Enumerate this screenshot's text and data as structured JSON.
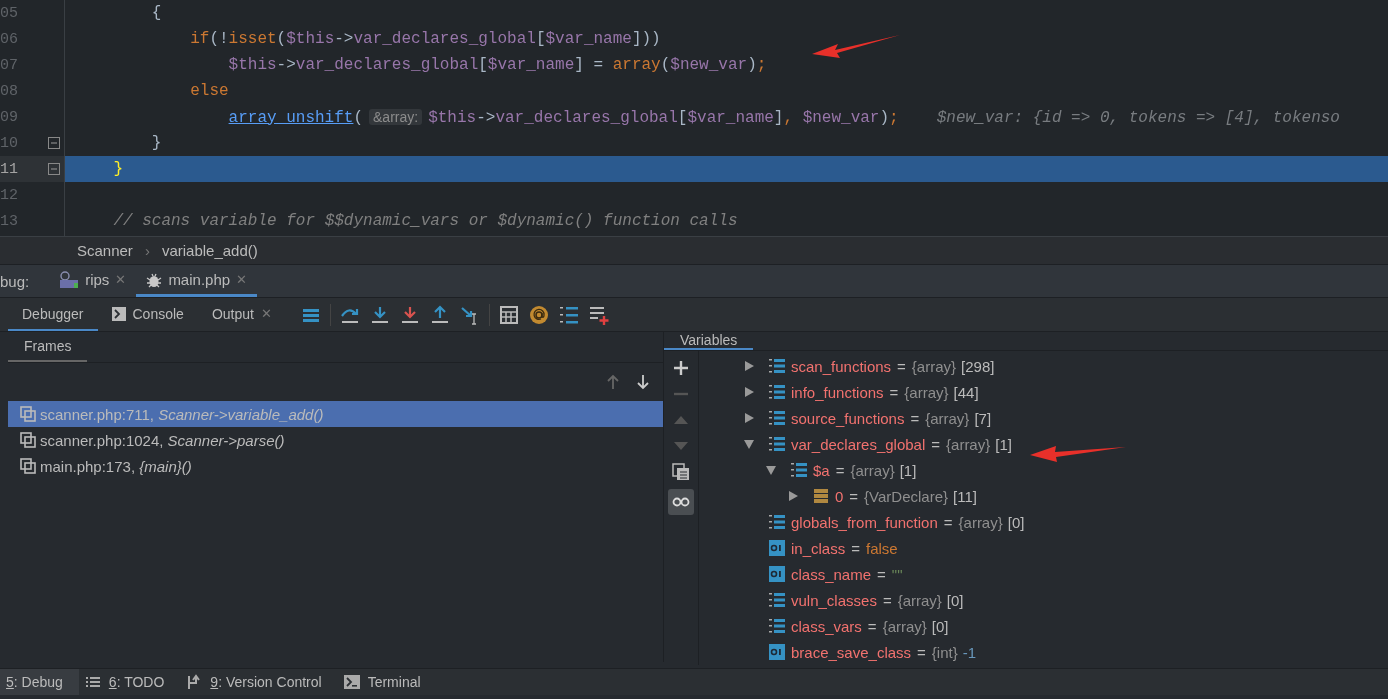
{
  "editor": {
    "lines": [
      {
        "number": "05",
        "kind": "block",
        "current": false,
        "tokens": [
          {
            "kind": "plain",
            "t": "{"
          }
        ]
      },
      {
        "number": "06",
        "kind": "statement",
        "current": false,
        "tokens": [
          {
            "kind": "kw",
            "t": "if"
          },
          {
            "kind": "plain",
            "t": "(!"
          },
          {
            "kind": "kw",
            "t": "isset"
          },
          {
            "kind": "plain",
            "t": "("
          },
          {
            "kind": "var",
            "t": "$this"
          },
          {
            "kind": "plain",
            "t": "->"
          },
          {
            "kind": "var",
            "t": "var_declares_global"
          },
          {
            "kind": "plain",
            "t": "["
          },
          {
            "kind": "var",
            "t": "$var_name"
          },
          {
            "kind": "plain",
            "t": "]))"
          }
        ]
      },
      {
        "number": "07",
        "kind": "nested",
        "current": false,
        "tokens": [
          {
            "kind": "var",
            "t": "$this"
          },
          {
            "kind": "plain",
            "t": "->"
          },
          {
            "kind": "var",
            "t": "var_declares_global"
          },
          {
            "kind": "plain",
            "t": "["
          },
          {
            "kind": "var",
            "t": "$var_name"
          },
          {
            "kind": "plain",
            "t": "] = "
          },
          {
            "kind": "kw",
            "t": "array"
          },
          {
            "kind": "plain",
            "t": "("
          },
          {
            "kind": "var",
            "t": "$new_var"
          },
          {
            "kind": "plain",
            "t": ")"
          },
          {
            "kind": "kw",
            "t": ";"
          }
        ]
      },
      {
        "number": "08",
        "kind": "statement",
        "current": false,
        "tokens": [
          {
            "kind": "kw",
            "t": "else"
          }
        ]
      },
      {
        "number": "09",
        "kind": "nested",
        "current": false,
        "tokens": [
          {
            "kind": "link",
            "t": "array_unshift"
          },
          {
            "kind": "plain",
            "t": "("
          },
          {
            "kind": "hint",
            "t": "&array:"
          },
          {
            "kind": "var",
            "t": "$this"
          },
          {
            "kind": "plain",
            "t": "->"
          },
          {
            "kind": "var",
            "t": "var_declares_global"
          },
          {
            "kind": "plain",
            "t": "["
          },
          {
            "kind": "var",
            "t": "$var_name"
          },
          {
            "kind": "plain",
            "t": "]"
          },
          {
            "kind": "kw",
            "t": ", "
          },
          {
            "kind": "var",
            "t": "$new_var"
          },
          {
            "kind": "plain",
            "t": ")"
          },
          {
            "kind": "kw",
            "t": ";"
          },
          {
            "kind": "inline",
            "t": "$new_var: {id => 0, tokens => [4], tokenso"
          }
        ]
      },
      {
        "number": "10",
        "kind": "block",
        "current": false,
        "tokens": [
          {
            "kind": "plain",
            "t": "}"
          }
        ]
      },
      {
        "number": "11",
        "kind": "method",
        "current": true,
        "tokens": [
          {
            "kind": "brace",
            "t": "}"
          }
        ]
      },
      {
        "number": "12",
        "kind": "blank",
        "current": false
      },
      {
        "number": "13",
        "kind": "method",
        "current": false,
        "tokens": [
          {
            "kind": "comment",
            "t": "// scans variable for $$dynamic_vars or $dynamic() function calls"
          }
        ]
      }
    ]
  },
  "breadcrumb": [
    {
      "label": "Scanner"
    },
    {
      "separator": "›",
      "label": "variable_add()"
    }
  ],
  "debug_bar": {
    "label": "bug:",
    "tabs": [
      {
        "label": "rips",
        "close": "✕",
        "selected": false
      },
      {
        "label": "main.php",
        "close": "✕",
        "selected": true
      }
    ]
  },
  "debug_tabs": [
    {
      "label": "Debugger",
      "selected": true
    },
    {
      "label": "Console",
      "selected": false
    },
    {
      "label": "Output",
      "close": "✕",
      "selected": false
    }
  ],
  "frames": {
    "title": "Frames",
    "items": [
      {
        "location": "scanner.php:711, ",
        "method": "Scanner->variable_add()",
        "selected": true
      },
      {
        "location": "scanner.php:1024, ",
        "method": "Scanner->parse()",
        "selected": false
      },
      {
        "location": "main.php:173, ",
        "method": "{main}()",
        "selected": false
      }
    ]
  },
  "variables": {
    "title": "Variables",
    "items": [
      {
        "kind": "array",
        "name": "scan_functions",
        "operator": "=",
        "type": "{array}",
        "value": {
          "kind": "plain",
          "text": "[298]"
        },
        "expanded": false
      },
      {
        "kind": "array",
        "name": "info_functions",
        "operator": "=",
        "type": "{array}",
        "value": {
          "kind": "plain",
          "text": "[44]"
        },
        "expanded": false
      },
      {
        "kind": "array",
        "name": "source_functions",
        "operator": "=",
        "type": "{array}",
        "value": {
          "kind": "plain",
          "text": "[7]"
        },
        "expanded": false
      },
      {
        "kind": "array",
        "name": "var_declares_global",
        "operator": "=",
        "type": "{array}",
        "value": {
          "kind": "plain",
          "text": "[1]"
        },
        "expanded": true,
        "children": [
          {
            "kind": "array",
            "name": "$a",
            "operator": "=",
            "type": "{array}",
            "value": {
              "kind": "plain",
              "text": "[1]"
            },
            "expanded": true,
            "children": [
              {
                "kind": "object",
                "name": "0",
                "operator": "=",
                "type": "{VarDeclare}",
                "value": {
                  "kind": "plain",
                  "text": "[11]"
                },
                "expanded": false
              }
            ]
          }
        ]
      },
      {
        "kind": "array",
        "name": "globals_from_function",
        "operator": "=",
        "type": "{array}",
        "value": {
          "kind": "plain",
          "text": "[0]"
        }
      },
      {
        "kind": "primitive",
        "name": "in_class",
        "operator": "=",
        "value": {
          "kind": "keyword",
          "text": "false"
        }
      },
      {
        "kind": "primitive",
        "name": "class_name",
        "operator": "=",
        "value": {
          "kind": "string",
          "text": "\"\""
        }
      },
      {
        "kind": "array",
        "name": "vuln_classes",
        "operator": "=",
        "type": "{array}",
        "value": {
          "kind": "plain",
          "text": "[0]"
        }
      },
      {
        "kind": "array",
        "name": "class_vars",
        "operator": "=",
        "type": "{array}",
        "value": {
          "kind": "plain",
          "text": "[0]"
        }
      },
      {
        "kind": "primitive",
        "name": "brace_save_class",
        "operator": "=",
        "type": "{int}",
        "value": {
          "kind": "number",
          "text": "-1"
        }
      }
    ]
  },
  "status_bar": [
    {
      "mnemonic": "5",
      "label": ": Debug",
      "selected": true
    },
    {
      "mnemonic": "6",
      "label": ": TODO",
      "selected": false
    },
    {
      "mnemonic": "9",
      "label": ": Version Control",
      "selected": false
    },
    {
      "label": "Terminal",
      "selected": false
    }
  ]
}
